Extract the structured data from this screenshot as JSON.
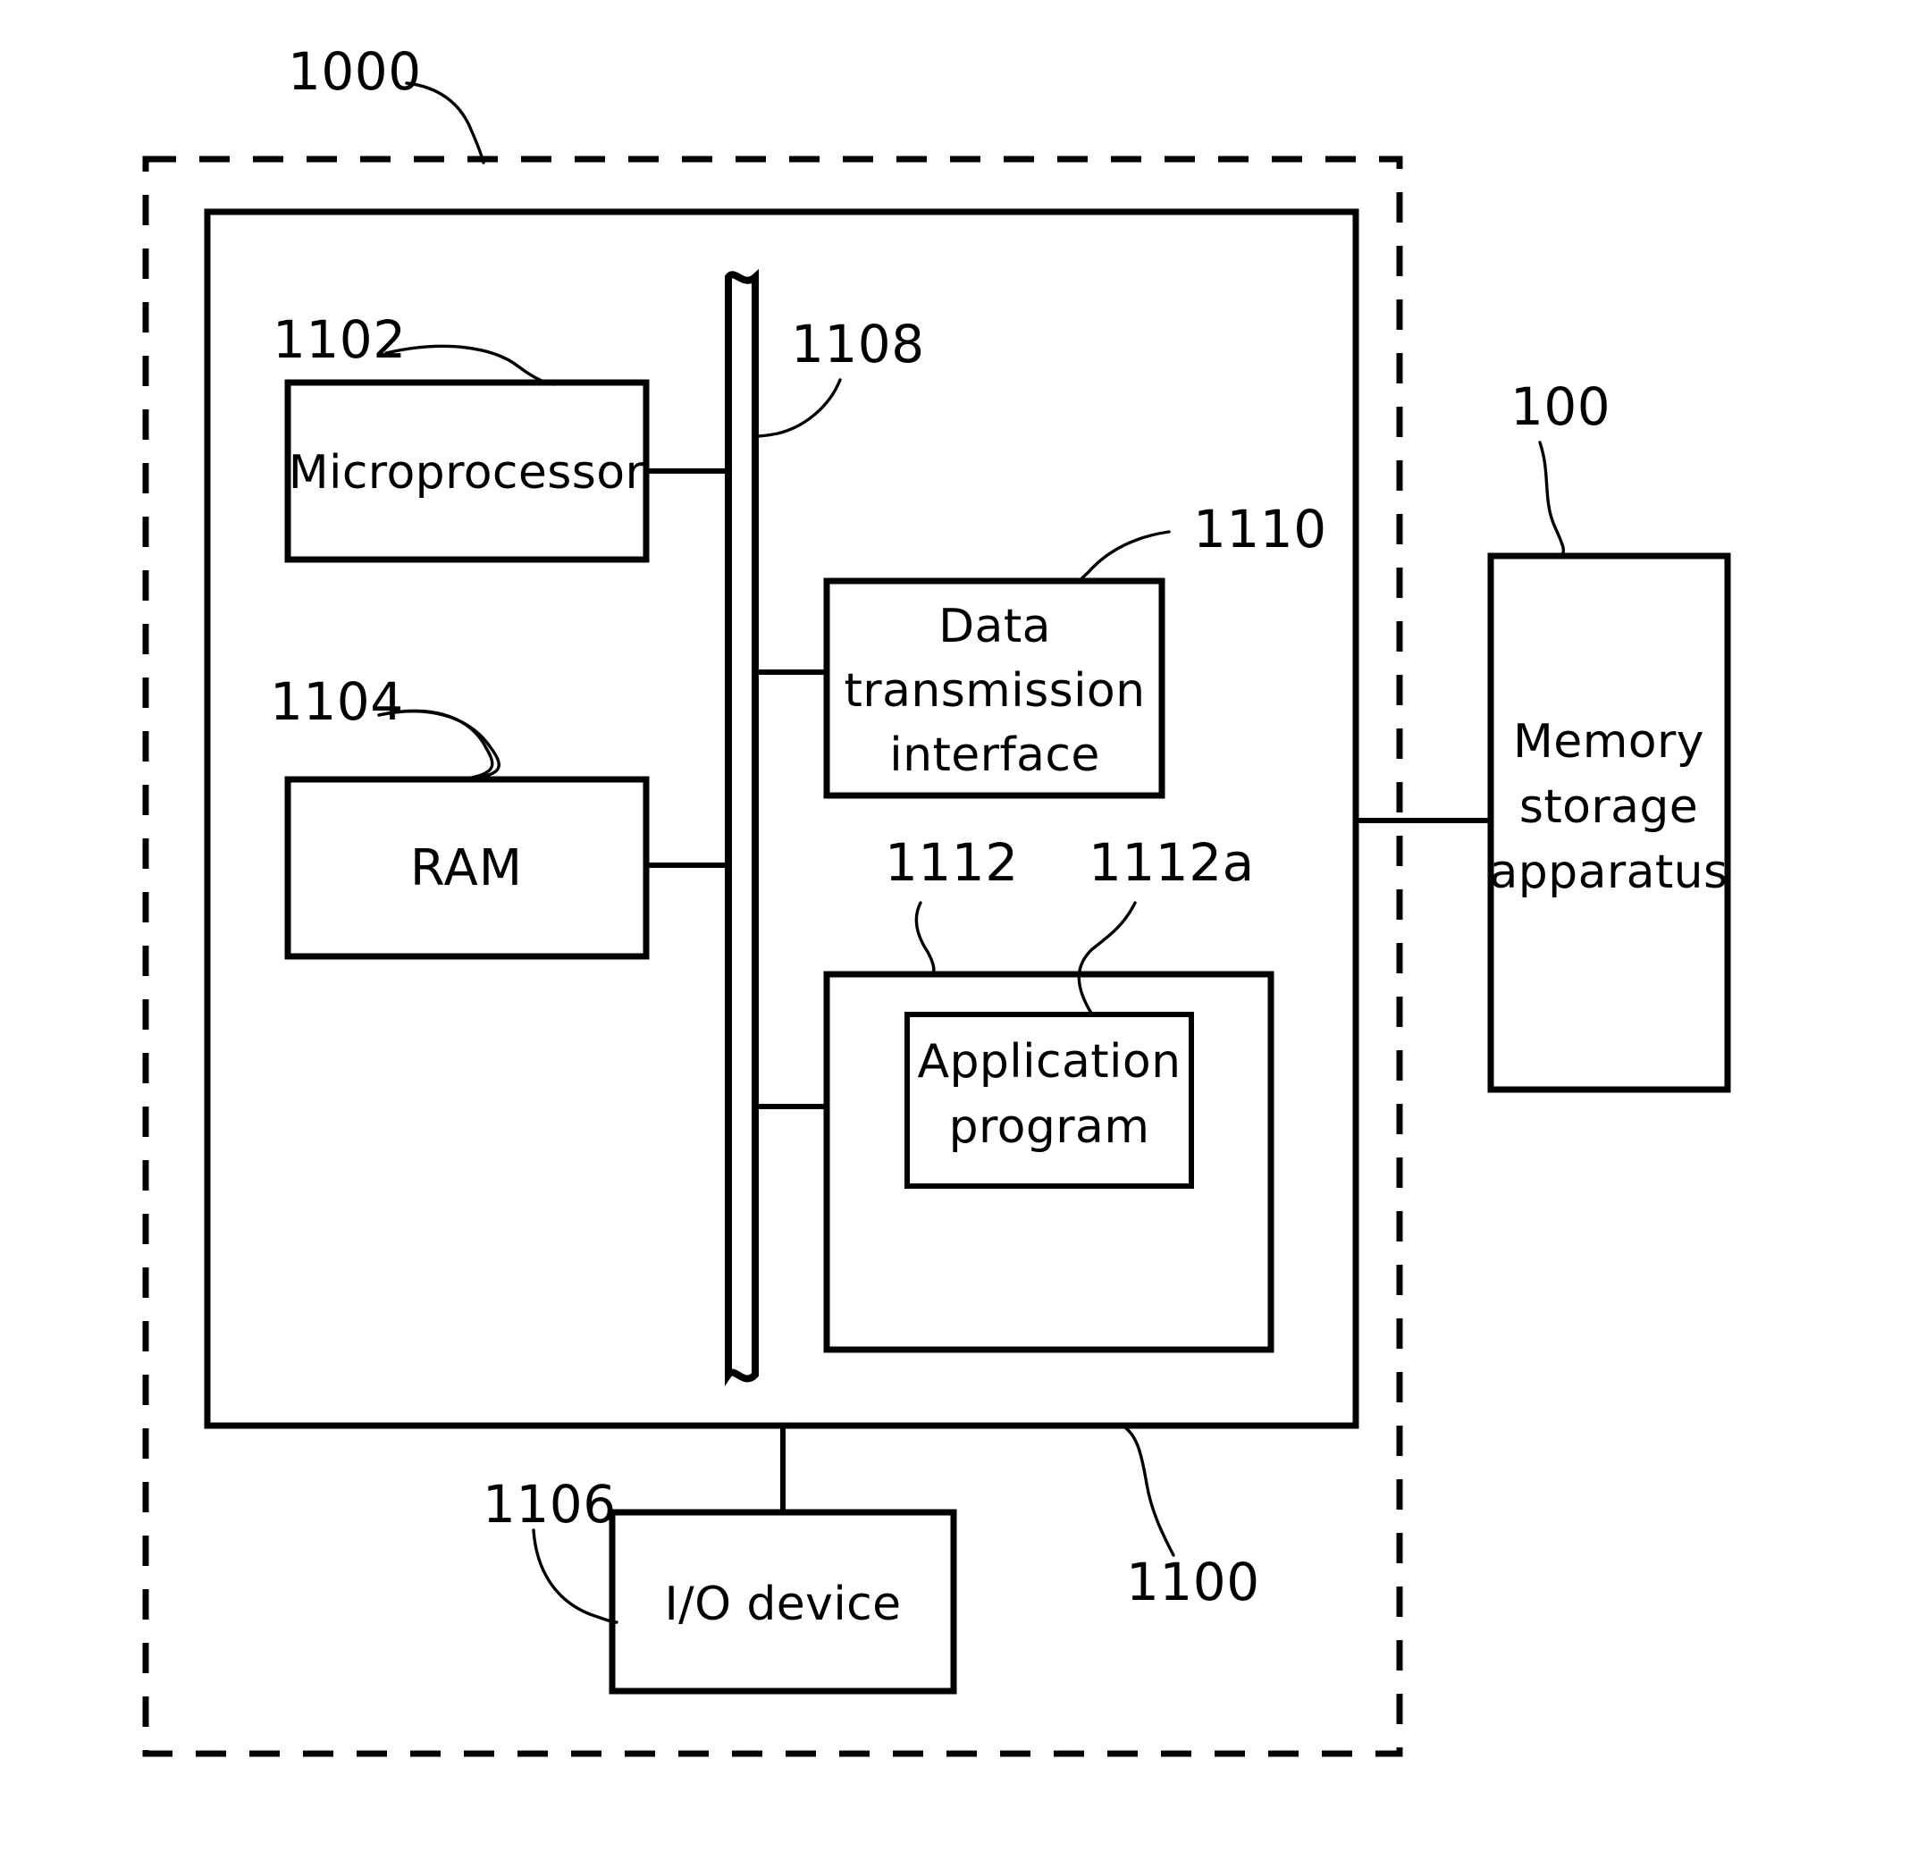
{
  "figure": {
    "type": "patent-block-diagram",
    "background_color": "#ffffff",
    "line_color": "#000000"
  },
  "reference_numerals": {
    "host_system": "1000",
    "memory_storage_apparatus": "100",
    "host_computer": "1100",
    "microprocessor": "1102",
    "ram": "1104",
    "io_device": "1106",
    "bus": "1108",
    "data_transmission_interface": "1110",
    "program_area": "1112",
    "application_program": "1112a"
  },
  "blocks": {
    "microprocessor": {
      "label": "Microprocessor"
    },
    "ram": {
      "label": "RAM"
    },
    "io_device": {
      "label": "I/O  device"
    },
    "data_transmission_interface": {
      "line1": "Data",
      "line2": "transmission",
      "line3": "interface"
    },
    "application_program": {
      "line1": "Application",
      "line2": "program"
    },
    "memory_storage_apparatus": {
      "line1": "Memory",
      "line2": "storage",
      "line3": "apparatus"
    }
  }
}
